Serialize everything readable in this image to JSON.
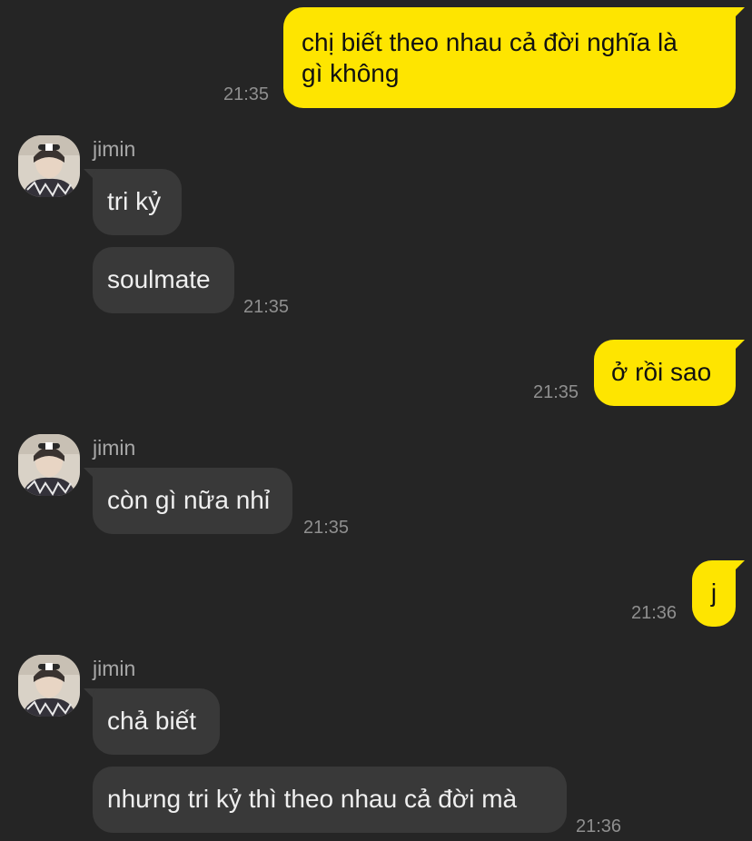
{
  "chat": {
    "sender_name": "jimin",
    "messages": [
      {
        "id": "m1",
        "direction": "outgoing",
        "lines": [
          "chị biết theo nhau cả đời nghĩa là",
          "gì không"
        ],
        "time": "21:35"
      },
      {
        "id": "m2",
        "direction": "incoming",
        "text": "tri kỷ"
      },
      {
        "id": "m3",
        "direction": "incoming",
        "text": "soulmate",
        "time": "21:35"
      },
      {
        "id": "m4",
        "direction": "outgoing",
        "text": "ở rồi sao",
        "time": "21:35"
      },
      {
        "id": "m5",
        "direction": "incoming",
        "text": "còn gì nữa nhỉ",
        "time": "21:35"
      },
      {
        "id": "m6",
        "direction": "outgoing",
        "text": "j",
        "time": "21:36"
      },
      {
        "id": "m7",
        "direction": "incoming",
        "text": "chả biết"
      },
      {
        "id": "m8",
        "direction": "incoming",
        "text": "nhưng tri kỷ thì theo nhau cả đời mà",
        "time": "21:36"
      }
    ]
  },
  "colors": {
    "background": "#252525",
    "outgoing_bubble": "#fee500",
    "incoming_bubble": "#393939",
    "timestamp": "#8f8f8f",
    "sender_name": "#a8a8a8"
  },
  "icons": {
    "avatar": "user-avatar-photo"
  }
}
